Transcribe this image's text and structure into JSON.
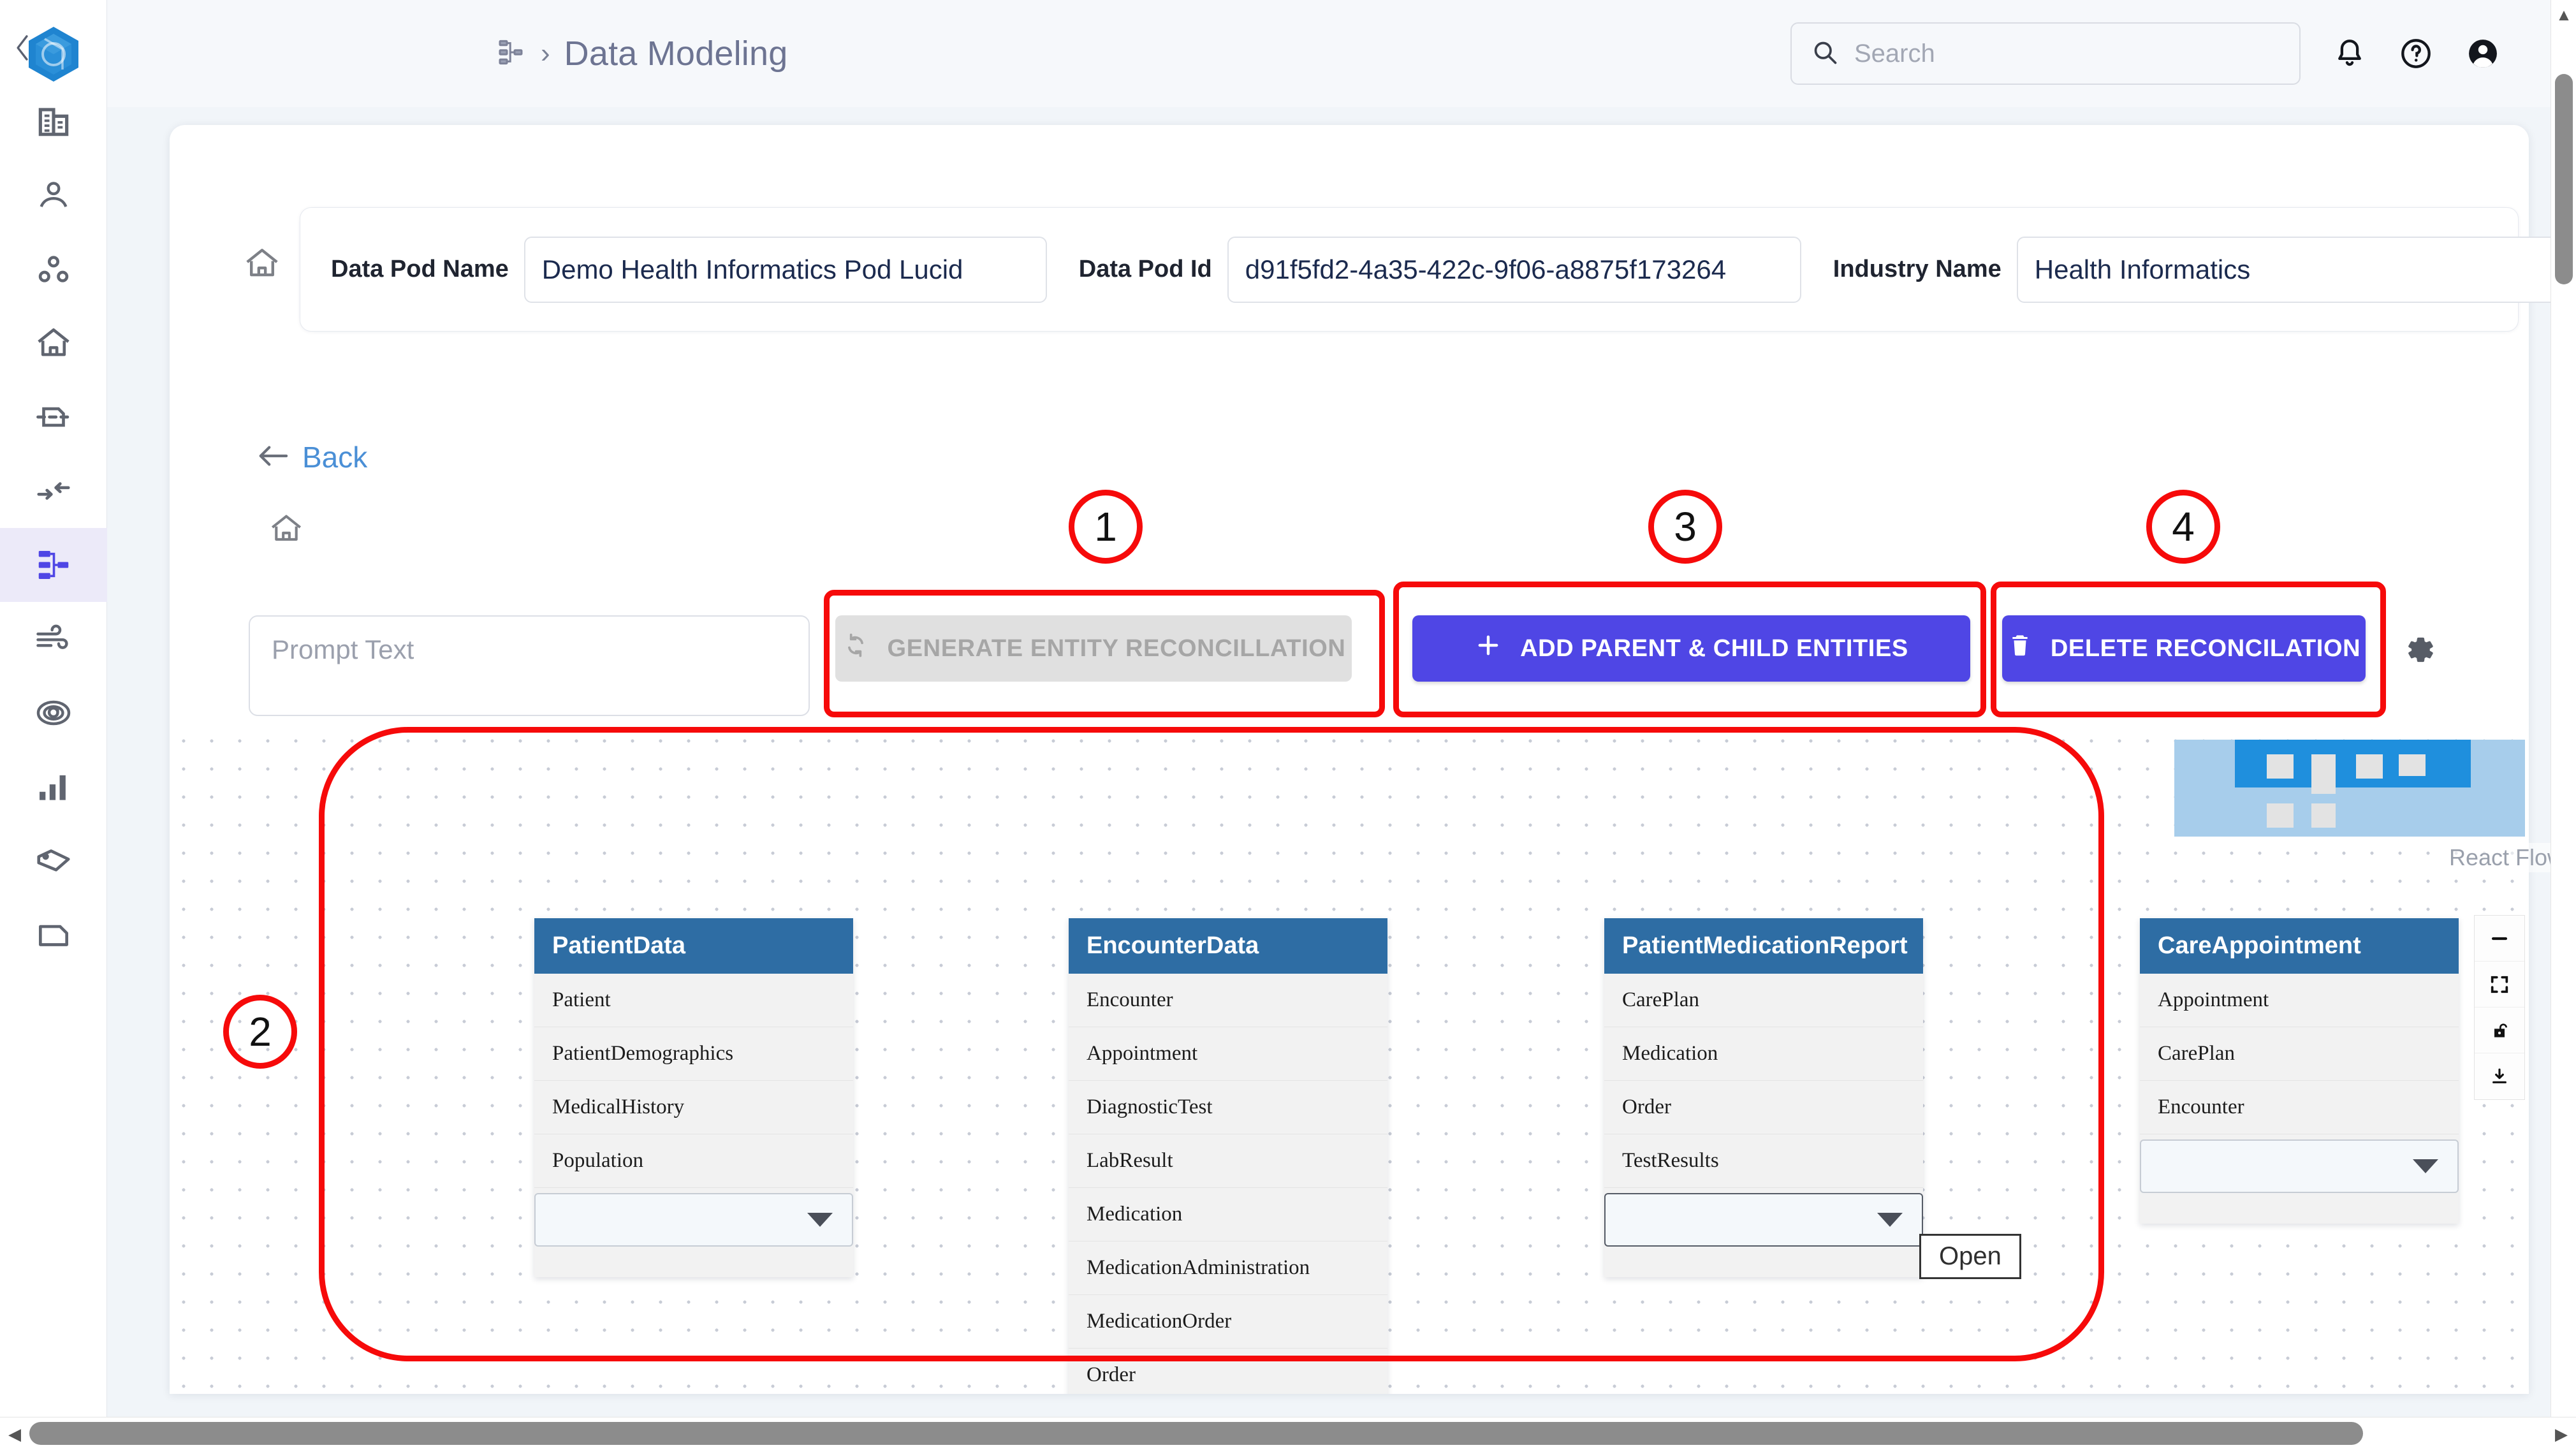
{
  "app": {
    "logo_icon": "cube-logo-icon",
    "collapse_icon": "chevron-left-icon"
  },
  "sidebar": {
    "items": [
      {
        "icon": "organization-icon",
        "name": "organization",
        "active": false
      },
      {
        "icon": "user-icon",
        "name": "user",
        "active": false
      },
      {
        "icon": "cluster-icon",
        "name": "cluster",
        "active": false
      },
      {
        "icon": "home-icon",
        "name": "home",
        "active": false
      },
      {
        "icon": "data-source-icon",
        "name": "data-source",
        "active": false
      },
      {
        "icon": "transform-arrows-icon",
        "name": "transform",
        "active": false
      },
      {
        "icon": "data-modeling-icon",
        "name": "data-modeling",
        "active": true
      },
      {
        "icon": "wind-flow-icon",
        "name": "pipeline",
        "active": false
      },
      {
        "icon": "target-icon",
        "name": "target",
        "active": false
      },
      {
        "icon": "bar-chart-icon",
        "name": "analytics",
        "active": false
      },
      {
        "icon": "tag-icon",
        "name": "tags",
        "active": false
      },
      {
        "icon": "document-icon",
        "name": "documents",
        "active": false
      }
    ]
  },
  "header": {
    "breadcrumb_icon": "data-modeling-icon",
    "breadcrumb_separator": "›",
    "title": "Data Modeling",
    "search": {
      "placeholder": "Search",
      "value": "",
      "icon": "search-icon"
    },
    "notifications_icon": "bell-icon",
    "help_icon": "help-circle-icon",
    "account_icon": "account-circle-icon"
  },
  "pod_info": {
    "home_icon": "home-icon",
    "fields": [
      {
        "label": "Data Pod Name",
        "value": "Demo Health Informatics Pod Lucid"
      },
      {
        "label": "Data Pod Id",
        "value": "d91f5fd2-4a35-422c-9f06-a8875f173264"
      },
      {
        "label": "Industry Name",
        "value": "Health Informatics"
      }
    ]
  },
  "back": {
    "icon": "arrow-left-icon",
    "label": "Back"
  },
  "canvas_home_icon": "home-icon",
  "toolbar": {
    "prompt": {
      "placeholder": "Prompt Text",
      "value": ""
    },
    "generate_label": "GENERATE ENTITY RECONCILLATION",
    "generate_icon": "refresh-sync-icon",
    "generate_disabled": true,
    "add_label": "ADD PARENT & CHILD ENTITIES",
    "add_icon": "plus-icon",
    "delete_label": "DELETE RECONCILATION",
    "delete_icon": "trash-icon",
    "settings_icon": "gear-icon",
    "accent_color": "#4f46e5",
    "disabled_bg": "#e0e0e0"
  },
  "graph": {
    "nodes": [
      {
        "title": "PatientData",
        "rows": [
          "Patient",
          "PatientDemographics",
          "MedicalHistory",
          "Population"
        ],
        "has_select": true,
        "select_value": "",
        "select_highlighted": false
      },
      {
        "title": "EncounterData",
        "rows": [
          "Encounter",
          "Appointment",
          "DiagnosticTest",
          "LabResult",
          "Medication",
          "MedicationAdministration",
          "MedicationOrder",
          "Order"
        ],
        "has_select": false,
        "select_value": "",
        "select_highlighted": false
      },
      {
        "title": "PatientMedicationReport",
        "rows": [
          "CarePlan",
          "Medication",
          "Order",
          "TestResults"
        ],
        "has_select": true,
        "select_value": "",
        "select_highlighted": true
      },
      {
        "title": "CareAppointment",
        "rows": [
          "Appointment",
          "CarePlan",
          "Encounter"
        ],
        "has_select": true,
        "select_value": "",
        "select_highlighted": false
      }
    ],
    "node_header_color": "#2e6da4",
    "tooltip": "Open",
    "minimap_label": "React Flow",
    "controls": [
      {
        "icon": "minus-icon",
        "name": "zoom-out"
      },
      {
        "icon": "fit-view-icon",
        "name": "fit-view"
      },
      {
        "icon": "lock-open-icon",
        "name": "toggle-interactivity"
      },
      {
        "icon": "download-icon",
        "name": "download"
      }
    ]
  },
  "annotations": [
    {
      "number": "1",
      "target": "generate-entity-reconcillation-button"
    },
    {
      "number": "2",
      "target": "entity-graph-canvas"
    },
    {
      "number": "3",
      "target": "add-parent-child-entities-button"
    },
    {
      "number": "4",
      "target": "delete-reconcilation-button"
    }
  ],
  "scrollbars": {
    "up_arrow": "▲",
    "down_arrow": "▼",
    "left_arrow": "◀",
    "right_arrow": "▶"
  }
}
